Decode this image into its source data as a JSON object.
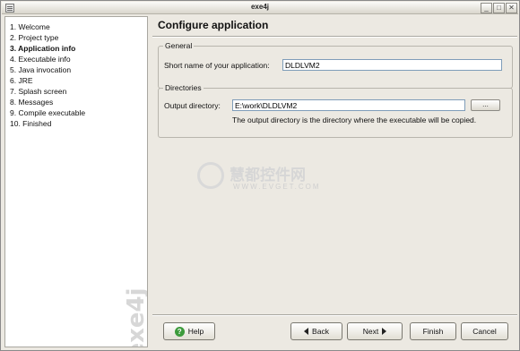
{
  "window": {
    "title": "exe4j",
    "controls": {
      "minimize": "_",
      "maximize": "□",
      "close": "✕"
    }
  },
  "sidebar": {
    "steps": [
      "1. Welcome",
      "2. Project type",
      "3. Application info",
      "4. Executable info",
      "5. Java invocation",
      "6. JRE",
      "7. Splash screen",
      "8. Messages",
      "9. Compile executable",
      "10. Finished"
    ],
    "active_index": 2,
    "brand": "exe4j"
  },
  "main": {
    "title": "Configure application",
    "general": {
      "legend": "General",
      "short_name_label": "Short name of your application:",
      "short_name_value": "DLDLVM2"
    },
    "directories": {
      "legend": "Directories",
      "output_label": "Output directory:",
      "output_value": "E:\\work\\DLDLVM2",
      "browse_label": "...",
      "hint": "The output directory is the directory where the executable will be copied."
    }
  },
  "watermark": {
    "chinese": "慧都控件网",
    "url": "WWW.EVGET.COM"
  },
  "buttons": {
    "help": "Help",
    "back": "Back",
    "next": "Next",
    "finish": "Finish",
    "cancel": "Cancel"
  },
  "icons": {
    "help": "help-icon",
    "back": "arrow-left-icon",
    "next": "arrow-right-icon"
  }
}
